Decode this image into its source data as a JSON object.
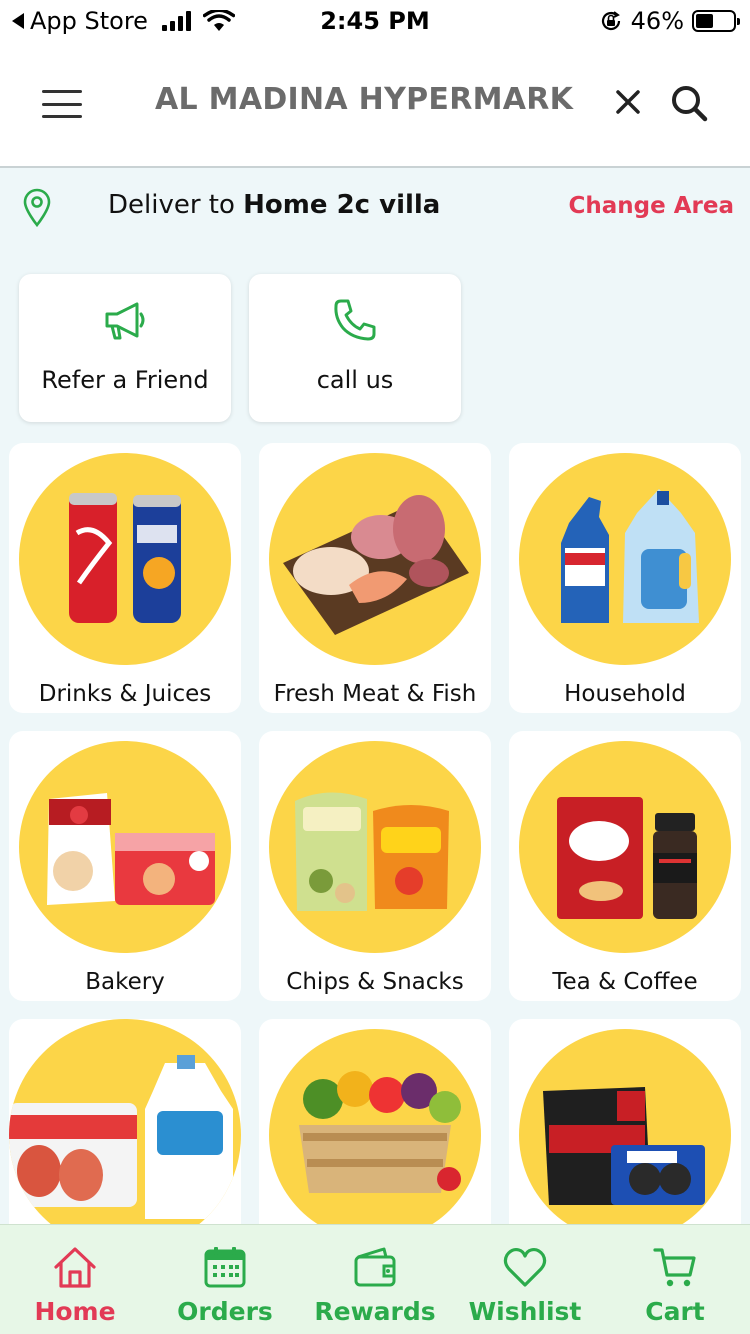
{
  "status_bar": {
    "back_label": "App Store",
    "time": "2:45 PM",
    "battery": "46%",
    "battery_level": 0.46,
    "icons": [
      "signal-icon",
      "wifi-icon",
      "orientation-lock-icon",
      "battery-icon"
    ]
  },
  "header": {
    "title": "AL MADINA HYPERMARKET...",
    "icons": [
      "menu-icon",
      "close-icon",
      "search-icon"
    ]
  },
  "delivery": {
    "prefix": "Deliver to ",
    "location": "Home 2c villa",
    "change_label": "Change Area"
  },
  "quick_actions": [
    {
      "label": "Refer a Friend",
      "icon": "megaphone-icon"
    },
    {
      "label": "call us",
      "icon": "phone-icon"
    }
  ],
  "categories": [
    {
      "label": "Drinks & Juices"
    },
    {
      "label": "Fresh Meat & Fish"
    },
    {
      "label": "Household"
    },
    {
      "label": "Bakery"
    },
    {
      "label": "Chips & Snacks"
    },
    {
      "label": "Tea & Coffee"
    },
    {
      "label": ""
    },
    {
      "label": ""
    },
    {
      "label": ""
    }
  ],
  "nav": {
    "items": [
      {
        "label": "Home",
        "icon": "home-icon",
        "active": true
      },
      {
        "label": "Orders",
        "icon": "calendar-icon",
        "active": false
      },
      {
        "label": "Rewards",
        "icon": "wallet-icon",
        "active": false
      },
      {
        "label": "Wishlist",
        "icon": "heart-icon",
        "active": false
      },
      {
        "label": "Cart",
        "icon": "cart-icon",
        "active": false
      }
    ]
  },
  "colors": {
    "accent_green": "#2bab4b",
    "accent_red": "#e23a55",
    "category_circle": "#fcd548",
    "page_background": "#eef7f9",
    "nav_background": "#e7f7e7"
  }
}
